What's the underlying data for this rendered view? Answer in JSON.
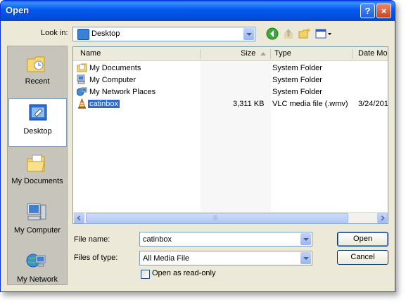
{
  "window": {
    "title": "Open",
    "help_label": "?",
    "close_label": "×"
  },
  "lookin": {
    "label": "Look in:",
    "value": "Desktop"
  },
  "toolbar": {
    "icons": [
      "back-icon",
      "up-folder-icon",
      "new-folder-icon",
      "views-menu-icon"
    ]
  },
  "places": [
    {
      "label": "Recent",
      "icon": "recent-folder-icon"
    },
    {
      "label": "Desktop",
      "icon": "desktop-icon",
      "selected": true
    },
    {
      "label": "My Documents",
      "icon": "my-documents-icon"
    },
    {
      "label": "My Computer",
      "icon": "my-computer-icon"
    },
    {
      "label": "My Network",
      "icon": "my-network-icon"
    }
  ],
  "columns": {
    "name": "Name",
    "size": "Size",
    "type": "Type",
    "date": "Date Mo"
  },
  "files": [
    {
      "name": "My Documents",
      "size": "",
      "type": "System Folder",
      "date": "",
      "icon": "folder-icon"
    },
    {
      "name": "My Computer",
      "size": "",
      "type": "System Folder",
      "date": "",
      "icon": "computer-icon"
    },
    {
      "name": "My Network Places",
      "size": "",
      "type": "System Folder",
      "date": "",
      "icon": "network-icon"
    },
    {
      "name": "catinbox",
      "size": "3,311 KB",
      "type": "VLC media file (.wmv)",
      "date": "3/24/201",
      "icon": "vlc-cone-icon",
      "selected": true
    }
  ],
  "scrollbar": {
    "grip": "|||"
  },
  "file_name": {
    "label": "File name:",
    "value": "catinbox"
  },
  "file_type": {
    "label": "Files of type:",
    "value": "All Media File"
  },
  "readonly": {
    "label": "Open as read-only",
    "checked": false
  },
  "buttons": {
    "open": "Open",
    "cancel": "Cancel"
  }
}
